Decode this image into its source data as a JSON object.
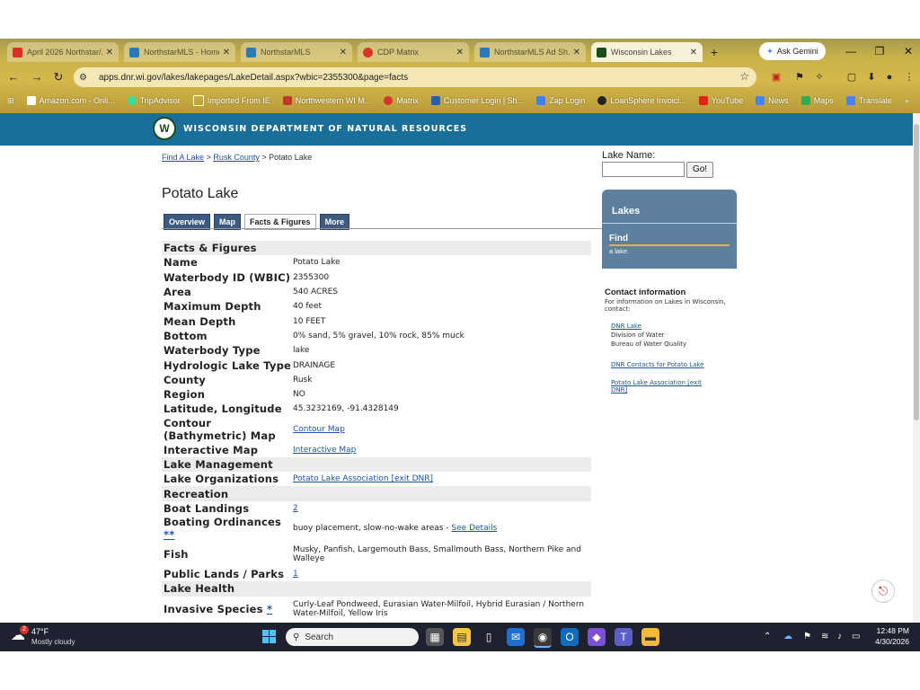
{
  "browser": {
    "tabs": [
      {
        "label": "April 2026 Northstar/...",
        "icon": "gmail-icon",
        "color": "#d93025",
        "active": false
      },
      {
        "label": "NorthstarMLS - Home",
        "icon": "mls-icon",
        "color": "#2a7ab8",
        "active": false
      },
      {
        "label": "NorthstarMLS",
        "icon": "mls-icon",
        "color": "#2a7ab8",
        "active": false
      },
      {
        "label": "CDP Matrix",
        "icon": "matrix-icon",
        "color": "#d9342b",
        "active": false
      },
      {
        "label": "NorthstarMLS Ad Sh...",
        "icon": "mls-icon",
        "color": "#2a7ab8",
        "active": false
      },
      {
        "label": "Wisconsin Lakes",
        "icon": "dnr-icon",
        "color": "#1b4d1b",
        "active": true
      }
    ],
    "new_tab": "+",
    "gemini": "Ask Gemini",
    "url": "apps.dnr.wi.gov/lakes/lakepages/LakeDetail.aspx?wbic=2355300&page=facts",
    "bookmarks": [
      "Amazon.com - Onli...",
      "TripAdvisor",
      "Imported From IE",
      "Northwestern WI M...",
      "Matrix",
      "Customer Login | Sh...",
      "Zap Login",
      "LoanSphere Invoici...",
      "YouTube",
      "News",
      "Maps",
      "Translate"
    ]
  },
  "site": {
    "banner": "WISCONSIN DEPARTMENT OF NATURAL RESOURCES"
  },
  "breadcrumb": {
    "link1": "Find A Lake",
    "sep": ">",
    "link2": "Rusk County",
    "current": "Potato Lake"
  },
  "page_title": "Potato Lake",
  "tabs": [
    "Overview",
    "Map",
    "Facts & Figures",
    "More"
  ],
  "facts": {
    "section_facts": "Facts & Figures",
    "name_k": "Name",
    "name_v": "Potato Lake",
    "wbic_k": "Waterbody ID (WBIC)",
    "wbic_v": "2355300",
    "area_k": "Area",
    "area_v": "540 ACRES",
    "maxdepth_k": "Maximum Depth",
    "maxdepth_v": "40 feet",
    "meandepth_k": "Mean Depth",
    "meandepth_v": "10 FEET",
    "bottom_k": "Bottom",
    "bottom_v": "0% sand, 5% gravel, 10% rock, 85% muck",
    "wtype_k": "Waterbody Type",
    "wtype_v": "lake",
    "htype_k": "Hydrologic Lake Type",
    "htype_v": "DRAINAGE",
    "county_k": "County",
    "county_v": "Rusk",
    "region_k": "Region",
    "region_v": "NO",
    "latlon_k": "Latitude, Longitude",
    "latlon_v": "45.3232169, -91.4328149",
    "contour_k": "Contour (Bathymetric) Map",
    "contour_v": "Contour Map",
    "imap_k": "Interactive Map",
    "imap_v": "Interactive Map",
    "section_mgmt": "Lake Management",
    "orgs_k": "Lake Organizations",
    "orgs_v": "Potato Lake Association [exit DNR]",
    "section_rec": "Recreation",
    "landings_k": "Boat Landings",
    "landings_v": "2",
    "ordin_k": "Boating Ordinances",
    "ordin_mark": "**",
    "ordin_v": "buoy placement, slow-no-wake areas -",
    "ordin_link": "See Details",
    "fish_k": "Fish",
    "fish_v": "Musky, Panfish, Largemouth Bass, Smallmouth Bass, Northern Pike and Walleye",
    "public_k": "Public Lands / Parks",
    "public_v": "1",
    "section_health": "Lake Health",
    "invasive_k": "Invasive Species",
    "invasive_mark": "*",
    "invasive_v": "Curly-Leaf Pondweed, Eurasian Water-Milfoil, Hybrid Eurasian / Northern Water-Milfoil, Yellow Iris"
  },
  "sidebar": {
    "lake_name_label": "Lake Name:",
    "go": "Go!",
    "lakes_title": "Lakes",
    "find": "Find",
    "find_sub": "a lake.",
    "contact_title": "Contact information",
    "contact_text": "For information on Lakes in Wisconsin, contact:",
    "dnr_lake": "DNR Lake",
    "division": "Division of Water",
    "bureau": "Bureau of Water Quality",
    "contacts_link": "DNR Contacts for Potato Lake",
    "assoc_link": "Potato Lake Association [exit DNR]"
  },
  "taskbar": {
    "temp": "47°F",
    "condition": "Mostly cloudy",
    "weather_badge": "2",
    "search": "Search",
    "time": "12:48 PM",
    "date": "4/30/2026"
  }
}
